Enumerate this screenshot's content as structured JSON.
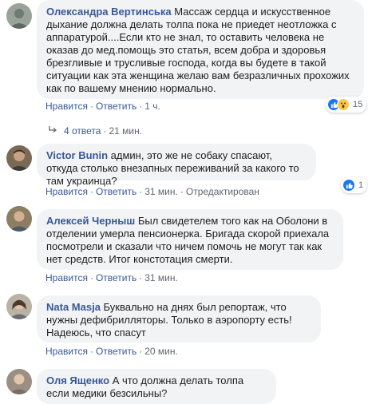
{
  "comments": [
    {
      "author": "Олександра Вертинська",
      "text": "Массаж сердца и искусственное дыхание должна делать толпа пока не приедет неотложка с аппаратурой....Если кто не знал, то оставить человека не оказав до мед.помощь это статья, всем добра и здоровья брезгливые и трусливые господа, когда вы будете в такой ситуации как эта женщина желаю вам безразличных прохожих как по вашему мнению нормально.",
      "like": "Нравится",
      "reply": "Ответить",
      "time": "1 ч.",
      "reactions_count": "15",
      "replies_label": "4 ответа",
      "replies_time": "21 мин."
    },
    {
      "author": "Victor Bunin",
      "text": "админ, это же не собаку спасают, откуда столько внезапных переживаний за какого то там украинца?",
      "like": "Нравится",
      "reply": "Ответить",
      "time": "31 мин.",
      "edited": "Отредактирован",
      "reactions_count": "1"
    },
    {
      "author": "Алексей Черныш",
      "text": "Был свидетелем того как на Оболони в отделении умерла пенсионерка. Бригада скорой приехала посмотрели и сказали что ничем помочь не могут так как нет средств. Итог констотация смерти.",
      "like": "Нравится",
      "reply": "Ответить",
      "time": "31 мин."
    },
    {
      "author": "Nata Masja",
      "text_line1": "Буквально на днях был репортаж, что нужны дефибрилляторы. Только в аэропорту есть!",
      "text_line2": "Надеюсь, что спасут",
      "like": "Нравится",
      "reply": "Ответить",
      "time": "20 мин."
    },
    {
      "author": "Оля Ященко",
      "text": "А что должна делать толпа если медики безсильны?"
    }
  ],
  "colors": {
    "author": "#385898",
    "bubble": "#f2f3f5",
    "meta": "#606770",
    "like_reaction": "#1877f2",
    "wow_reaction": "#f7c94a"
  },
  "icons": [
    "like-reaction-icon",
    "wow-reaction-icon",
    "reply-arrow-icon",
    "avatar"
  ]
}
